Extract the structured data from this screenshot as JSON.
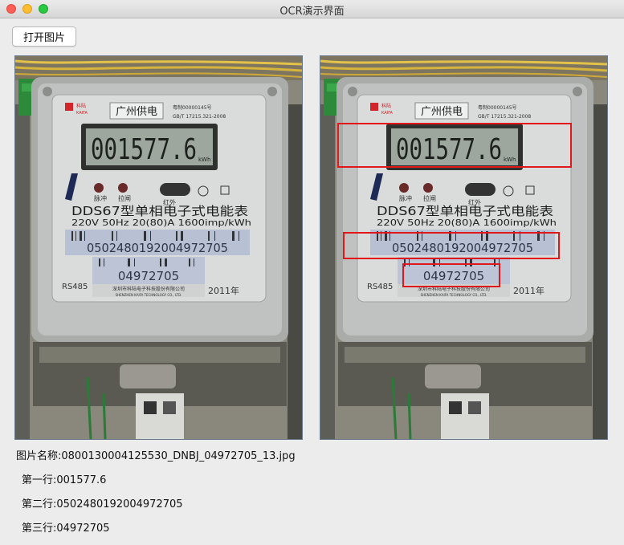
{
  "window": {
    "title": "OCR演示界面"
  },
  "toolbar": {
    "open_label": "打开图片"
  },
  "meter": {
    "brand_cn": "科陆",
    "brand_en": "KAIFA",
    "supplier": "广州供电",
    "cert": "粤制00000145号",
    "standard": "GB/T 17215.321-2008",
    "reading": "001577.6",
    "unit": "kWh",
    "pulse_label": "脉冲",
    "trip_label": "拉闸",
    "ir_label": "红外",
    "model": "DDS67型单相电子式电能表",
    "spec": "220V  50Hz  20(80)A  1600imp/kWh",
    "barcode_number": "0502480192004972705",
    "serial": "04972705",
    "interface": "RS485",
    "maker": "深圳市科陆电子科技股份有限公司",
    "maker_en": "SHENZHEN KAIFA TECHNOLOGY CO., LTD.",
    "year": "2011年"
  },
  "detections": {
    "box_color": "#e0181b"
  },
  "result": {
    "filename_label": "图片名称:",
    "filename": "0800130004125530_DNBJ_04972705_13.jpg",
    "lines": [
      {
        "label": "第一行:",
        "value": "001577.6"
      },
      {
        "label": "第二行:",
        "value": "0502480192004972705"
      },
      {
        "label": "第三行:",
        "value": "04972705"
      }
    ]
  }
}
